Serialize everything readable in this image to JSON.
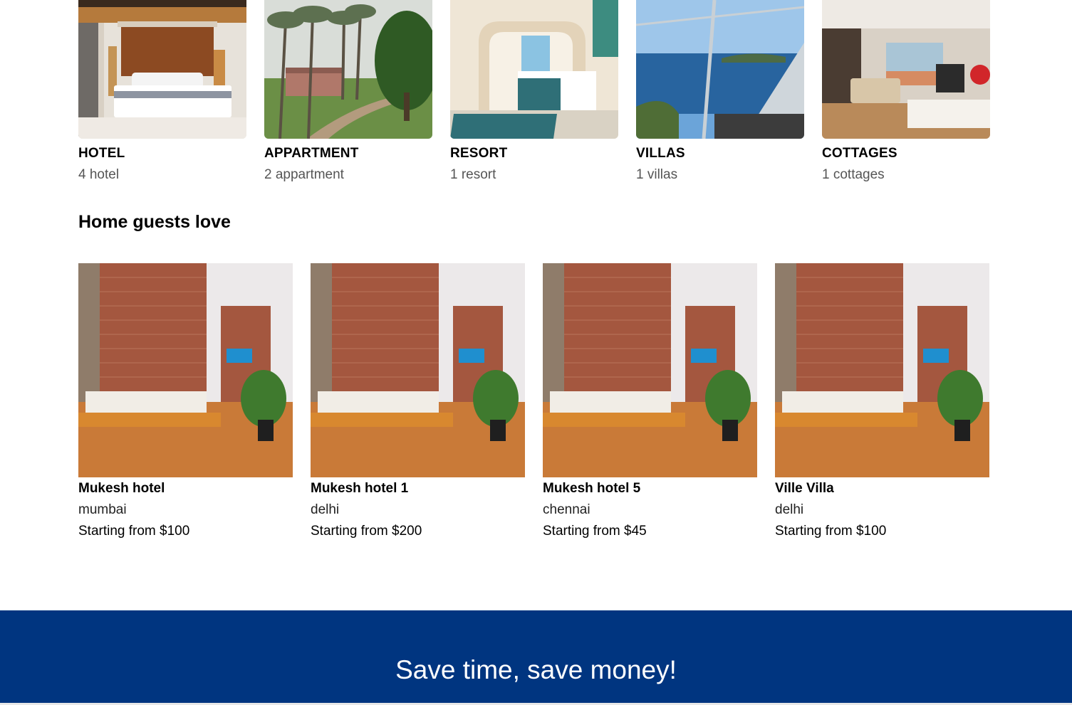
{
  "property_types": [
    {
      "title": "HOTEL",
      "count": "4 hotel",
      "image": "hotel-room-photo"
    },
    {
      "title": "APPARTMENT",
      "count": "2 appartment",
      "image": "apartment-grounds-photo"
    },
    {
      "title": "RESORT",
      "count": "1 resort",
      "image": "resort-room-photo"
    },
    {
      "title": "VILLAS",
      "count": "1 villas",
      "image": "villa-sea-view-photo"
    },
    {
      "title": "COTTAGES",
      "count": "1 cottages",
      "image": "cottage-living-room-photo"
    }
  ],
  "home_guests_love": {
    "title": "Home guests love",
    "items": [
      {
        "name": "Mukesh hotel",
        "city": "mumbai",
        "price": "Starting from $100"
      },
      {
        "name": "Mukesh hotel 1",
        "city": "delhi",
        "price": "Starting from $200"
      },
      {
        "name": "Mukesh hotel 5",
        "city": "chennai",
        "price": "Starting from $45"
      },
      {
        "name": "Ville Villa",
        "city": "delhi",
        "price": "Starting from $100"
      }
    ]
  },
  "banner": {
    "title": "Save time, save money!"
  },
  "colors": {
    "banner_bg": "#003580",
    "text": "#000000",
    "muted_text": "#555555"
  }
}
